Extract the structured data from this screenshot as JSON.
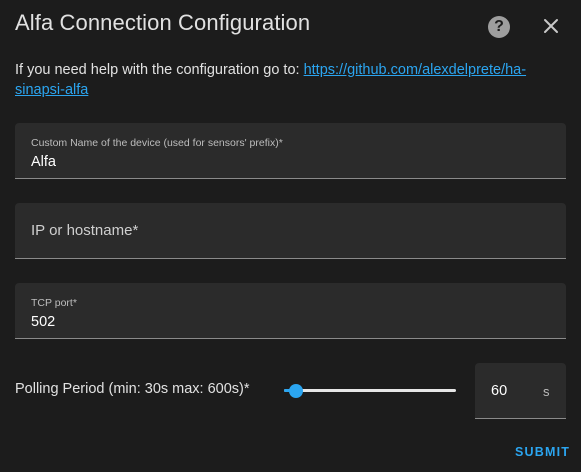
{
  "dialog": {
    "title": "Alfa Connection Configuration",
    "help_text_prefix": "If you need help with the configuration go to: ",
    "help_link": "https://github.com/alexdelprete/ha-sinapsi-alfa"
  },
  "fields": {
    "name": {
      "label": "Custom Name of the device (used for sensors' prefix)*",
      "value": "Alfa"
    },
    "host": {
      "placeholder": "IP or hostname*",
      "value": ""
    },
    "port": {
      "label": "TCP port*",
      "value": "502"
    }
  },
  "polling": {
    "label": "Polling Period (min: 30s max: 600s)*",
    "value": "60",
    "suffix": "s",
    "min": 30,
    "max": 600,
    "current": 60
  },
  "actions": {
    "submit": "SUBMIT"
  },
  "colors": {
    "accent": "#2ba5f0",
    "background": "#1c1c1c",
    "field_bg": "#2b2b2b"
  },
  "icons": {
    "help": "help-circle-icon",
    "close": "close-icon"
  }
}
